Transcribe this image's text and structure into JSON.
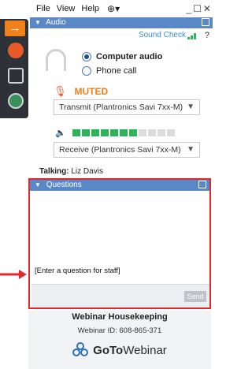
{
  "menubar": {
    "items": [
      "File",
      "View",
      "Help"
    ],
    "globe_icon": "globe-icon"
  },
  "audio": {
    "header": "Audio",
    "sound_check": "Sound Check",
    "help": "?",
    "options": [
      "Computer audio",
      "Phone call"
    ],
    "selected": "Computer audio",
    "muted": "MUTED",
    "transmit_device": "Transmit (Plantronics Savi 7xx-M)",
    "receive_device": "Receive (Plantronics Savi 7xx-M)",
    "volume_level": 0.64
  },
  "talking": {
    "label": "Talking:",
    "name": "Liz Davis"
  },
  "questions": {
    "header": "Questions",
    "input_placeholder": "[Enter a question for staff]",
    "send_label": "Send"
  },
  "webinar": {
    "title": "Webinar Housekeeping",
    "id_text": "Webinar ID: 608-865-371",
    "logo_text_bold": "GoTo",
    "logo_text": "Webinar"
  },
  "colors": {
    "accent": "#f0821e",
    "header_blue": "#5a88c6",
    "highlight_red": "#e0292f",
    "level_green": "#2db35a"
  }
}
